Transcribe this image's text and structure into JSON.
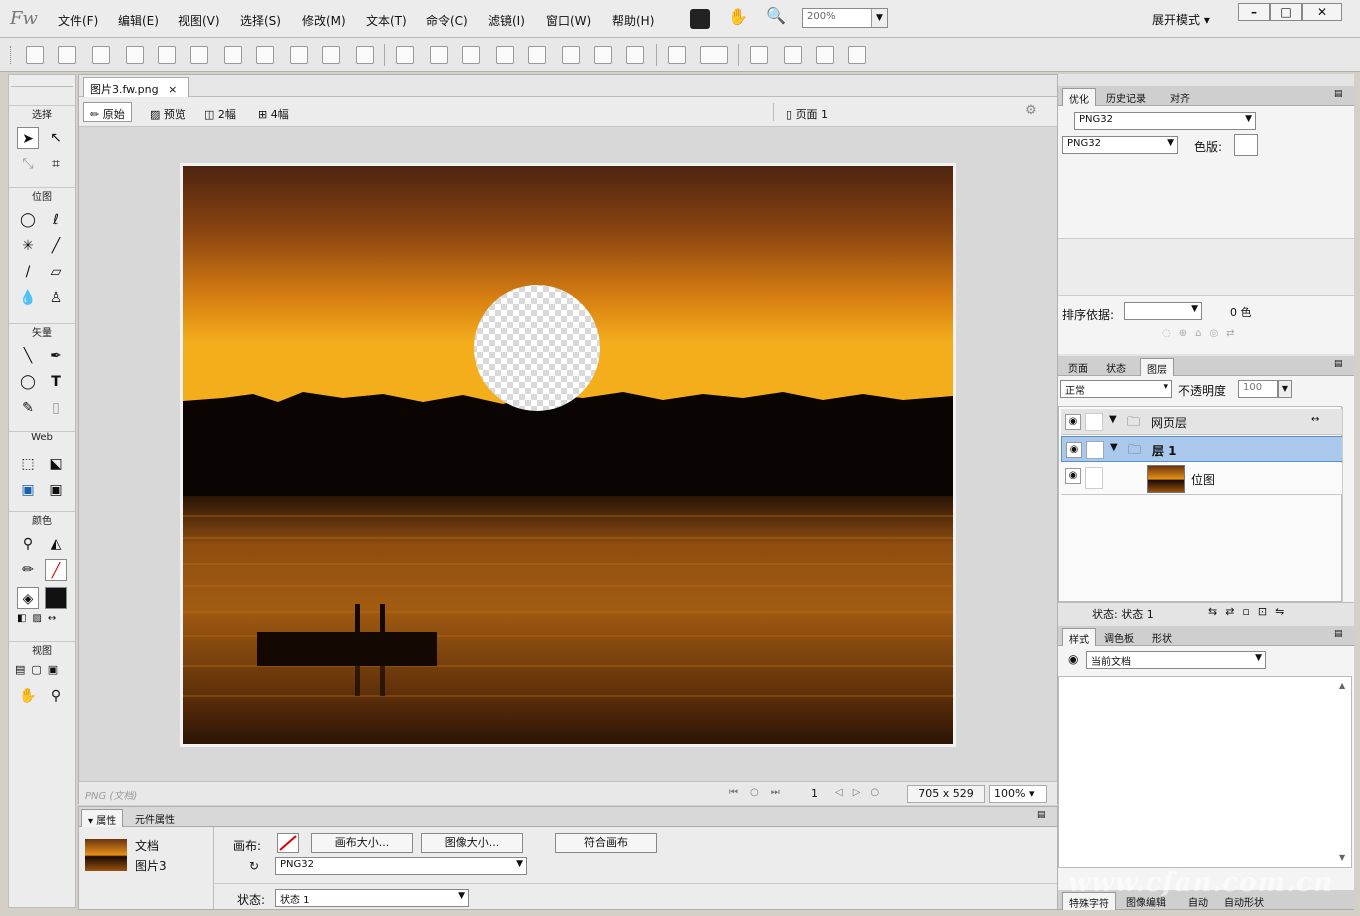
{
  "app": {
    "logo": "Fw"
  },
  "menu": [
    "文件(F)",
    "编辑(E)",
    "视图(V)",
    "选择(S)",
    "修改(M)",
    "文本(T)",
    "命令(C)",
    "滤镜(I)",
    "窗口(W)",
    "帮助(H)"
  ],
  "zoom_select": "200%",
  "workspace_mode": "展开模式",
  "tools": {
    "sections": [
      "选择",
      "位图",
      "矢量",
      "Web",
      "颜色",
      "视图"
    ]
  },
  "document": {
    "tab_label": "图片3.fw.png",
    "tab_close": "×",
    "views": {
      "original": "原始",
      "preview": "预览",
      "two_up": "2幅",
      "four_up": "4幅"
    },
    "page_label": "页面 1"
  },
  "status": {
    "format": "PNG (文档)",
    "page_number": "1",
    "dimensions": "705 x 529",
    "zoom": "100%"
  },
  "properties": {
    "tabs": [
      "属性",
      "元件属性"
    ],
    "doc_type": "文档",
    "doc_name": "图片3",
    "canvas_label": "画布:",
    "canvas_size_btn": "画布大小...",
    "image_size_btn": "图像大小...",
    "fit_canvas_btn": "符合画布",
    "format_value": "PNG32",
    "state_label": "状态:",
    "state_value": "状态 1"
  },
  "optimize_panel": {
    "tabs": [
      "优化",
      "历史记录",
      "对齐"
    ],
    "preset": "PNG32",
    "format": "PNG32",
    "matte_label": "色版:",
    "sort_label": "排序依据:",
    "color_count": "0 色"
  },
  "layers_panel": {
    "tabs": [
      "页面",
      "状态",
      "图层"
    ],
    "blend_mode": "正常",
    "opacity_label": "不透明度",
    "opacity_value": "100",
    "layers": [
      {
        "name": "网页层",
        "type": "folder"
      },
      {
        "name": "层 1",
        "type": "folder",
        "selected": true
      },
      {
        "name": "位图",
        "type": "bitmap"
      }
    ],
    "footer_status": "状态 1"
  },
  "styles_panel": {
    "tabs": [
      "样式",
      "调色板",
      "形状"
    ],
    "doc_select": "当前文档"
  },
  "bottom_tabs": [
    "特殊字符",
    "图像编辑",
    "自动",
    "自动形状"
  ],
  "watermark": "www.cfan.com.cn",
  "colors": {
    "selection": "#a9c8ec",
    "sky_top": "#5a2a10",
    "sky_mid": "#e08a10",
    "sky_bottom": "#f4b020"
  }
}
